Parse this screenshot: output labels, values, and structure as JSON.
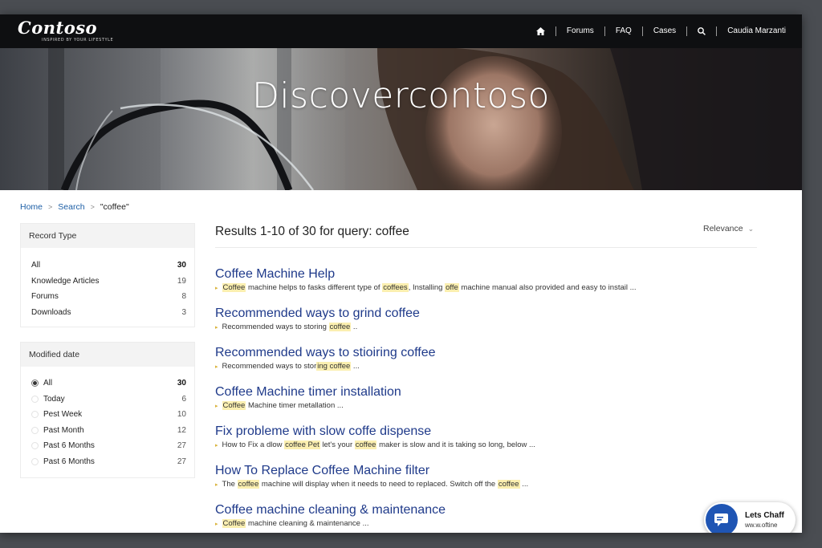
{
  "header": {
    "logo_text": "Contoso",
    "logo_tagline": "INSPIRED BY YOUR LIFESTYLE",
    "nav": {
      "forums": "Forums",
      "faq": "FAQ",
      "cases": "Cases",
      "user": "Caudia Marzanti"
    }
  },
  "hero": {
    "title": "Discovercontoso"
  },
  "breadcrumb": {
    "home": "Home",
    "search": "Search",
    "current": "\"coffee\""
  },
  "filters": {
    "record_type": {
      "title": "Record Type",
      "items": [
        {
          "label": "All",
          "count": "30"
        },
        {
          "label": "Knowledge Articles",
          "count": "19"
        },
        {
          "label": "Forums",
          "count": "8"
        },
        {
          "label": "Downloads",
          "count": "3"
        }
      ]
    },
    "modified_date": {
      "title": "Modified date",
      "items": [
        {
          "label": "All",
          "count": "30"
        },
        {
          "label": "Today",
          "count": "6"
        },
        {
          "label": "Pest Week",
          "count": "10"
        },
        {
          "label": "Past Month",
          "count": "12"
        },
        {
          "label": "Past 6 Months",
          "count": "27"
        },
        {
          "label": "Past 6 Months",
          "count": "27"
        }
      ]
    }
  },
  "results": {
    "heading": "Results 1-10 of 30 for query: coffee",
    "sort_label": "Relevance",
    "items": [
      {
        "title": "Coffee Machine Help",
        "snippet": [
          [
            "Coffee",
            true
          ],
          [
            " machine helps to fasks different type of ",
            false
          ],
          [
            "coffees",
            true
          ],
          [
            ", Installing ",
            false
          ],
          [
            "offe",
            true
          ],
          [
            " machine manual also provided and easy to instail ...",
            false
          ]
        ]
      },
      {
        "title": "Recommended ways to grind coffee",
        "snippet": [
          [
            "Recommended ways to storing ",
            false
          ],
          [
            "coffee",
            true
          ],
          [
            " ..",
            false
          ]
        ]
      },
      {
        "title": "Recommended ways to stioiring coffee",
        "snippet": [
          [
            "Recommended ways to stor",
            false
          ],
          [
            "ing coffee",
            true
          ],
          [
            " ...",
            false
          ]
        ]
      },
      {
        "title": "Coffee Machine timer installation",
        "snippet": [
          [
            "Coffee",
            true
          ],
          [
            " Machine timer metallation ...",
            false
          ]
        ]
      },
      {
        "title": "Fix probleme with slow coffe dispense",
        "snippet": [
          [
            "How to Fix a dlow ",
            false
          ],
          [
            "coffee Pet",
            true
          ],
          [
            " let's your ",
            false
          ],
          [
            "coffee",
            true
          ],
          [
            " maker is slow and it is taking so long, below ...",
            false
          ]
        ]
      },
      {
        "title": "How To Replace Coffee Machine filter",
        "snippet": [
          [
            "The ",
            false
          ],
          [
            "coffee",
            true
          ],
          [
            " machine will display when it needs to need to replaced. Switch off the ",
            false
          ],
          [
            "coffee",
            true
          ],
          [
            " ...",
            false
          ]
        ]
      },
      {
        "title": "Coffee machine cleaning & maintenance",
        "snippet": [
          [
            "Coffee",
            true
          ],
          [
            " machine cleaning & maintenance ...",
            false
          ]
        ]
      }
    ]
  },
  "chat": {
    "title": "Lets Chaff",
    "subtitle": "ww.w.oftine"
  },
  "colors": {
    "link": "#1f3a8a",
    "highlight": "#fbefb0",
    "chat_accent": "#1f55b4",
    "header_bg": "#0e0f11"
  }
}
